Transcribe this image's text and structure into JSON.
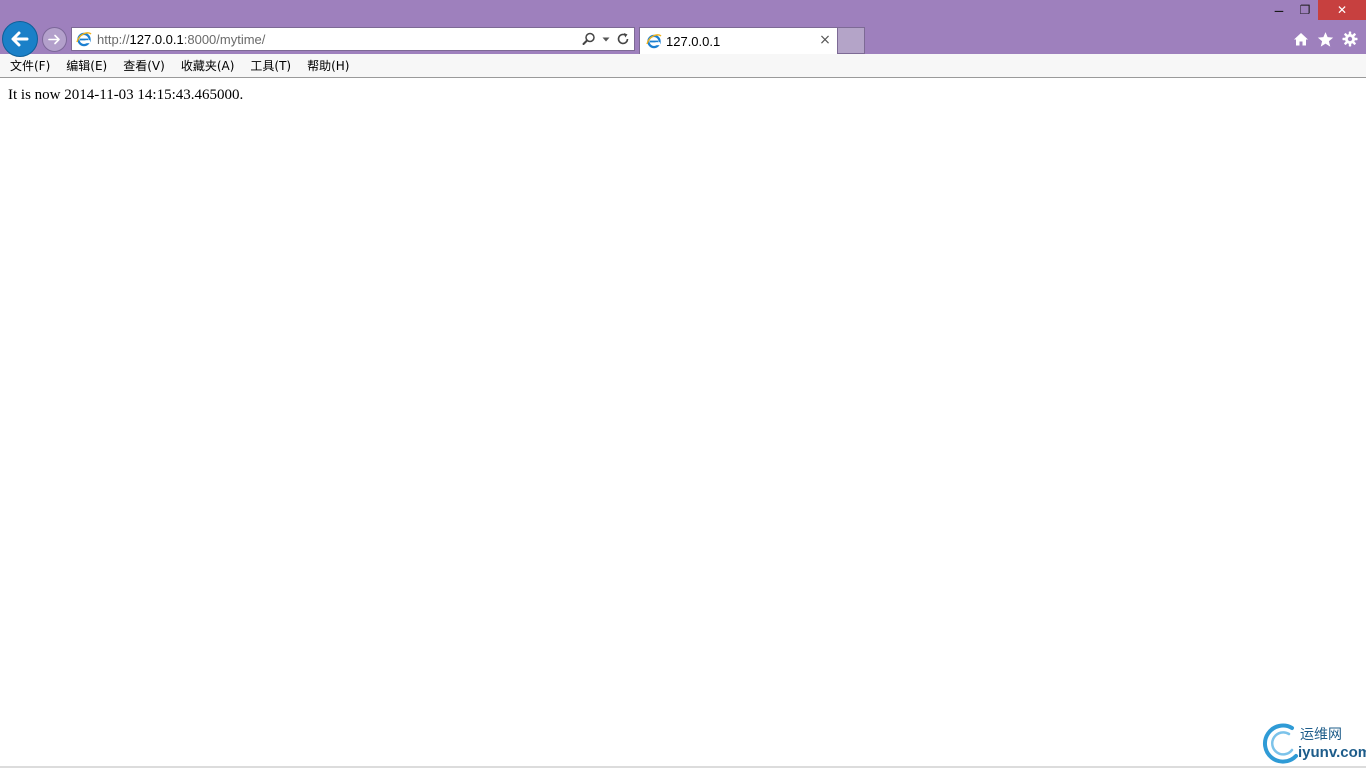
{
  "window": {
    "minimize_glyph": "‒",
    "restore_glyph": "❐",
    "close_glyph": "✕"
  },
  "address_bar": {
    "scheme": "http://",
    "host": "127.0.0.1",
    "path": ":8000/mytime/"
  },
  "tab": {
    "title": "127.0.0.1",
    "close_glyph": "×"
  },
  "menu": {
    "items": [
      "文件(F)",
      "编辑(E)",
      "查看(V)",
      "收藏夹(A)",
      "工具(T)",
      "帮助(H)"
    ]
  },
  "page": {
    "text": "It is now 2014-11-03 14:15:43.465000."
  },
  "watermark": {
    "cn": "运维网",
    "en": "iyunv.com"
  },
  "colors": {
    "chrome": "#9e80bd",
    "back_button": "#1a80c8",
    "close_button": "#c7403f",
    "menubar": "#f7f7f7"
  },
  "icons": [
    "back-arrow-icon",
    "forward-arrow-icon",
    "ie-logo-icon",
    "search-icon",
    "dropdown-icon",
    "refresh-icon",
    "home-icon",
    "favorites-star-icon",
    "gear-icon"
  ]
}
